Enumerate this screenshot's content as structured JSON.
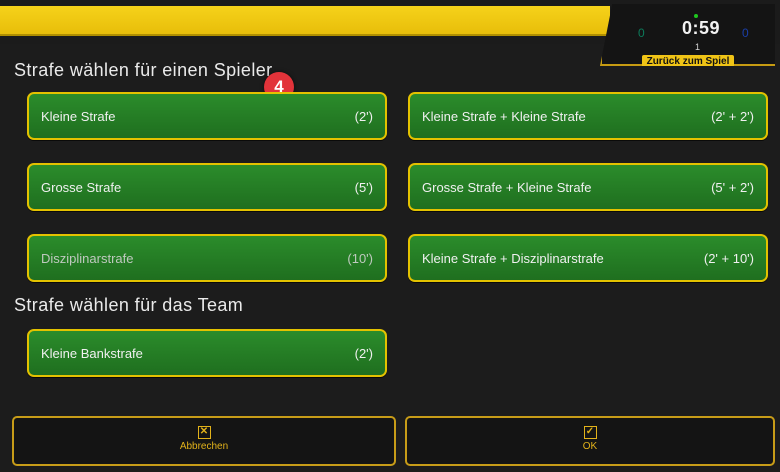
{
  "scoreboard": {
    "home_score": "0",
    "time": "0:59",
    "period": "1",
    "away_score": "0",
    "back_label": "Zurück zum Spiel"
  },
  "player_section": {
    "title": "Strafe wählen für einen Spieler",
    "step_badge": "4",
    "buttons": [
      {
        "label": "Kleine Strafe",
        "time": "(2')"
      },
      {
        "label": "Kleine Strafe + Kleine Strafe",
        "time": "(2' + 2')"
      },
      {
        "label": "Grosse Strafe",
        "time": "(5')"
      },
      {
        "label": "Grosse Strafe + Kleine Strafe",
        "time": "(5' + 2')"
      },
      {
        "label": "Disziplinarstrafe",
        "time": "(10')"
      },
      {
        "label": "Kleine Strafe + Disziplinarstrafe",
        "time": "(2' + 10')"
      }
    ]
  },
  "team_section": {
    "title": "Strafe wählen für das Team",
    "buttons": [
      {
        "label": "Kleine Bankstrafe",
        "time": "(2')"
      }
    ]
  },
  "footer": {
    "cancel_label": "Abbrechen",
    "ok_label": "OK"
  },
  "colors": {
    "accent_yellow": "#e3c200",
    "button_green": "#1f6f1f",
    "badge_red": "#e2333a"
  }
}
